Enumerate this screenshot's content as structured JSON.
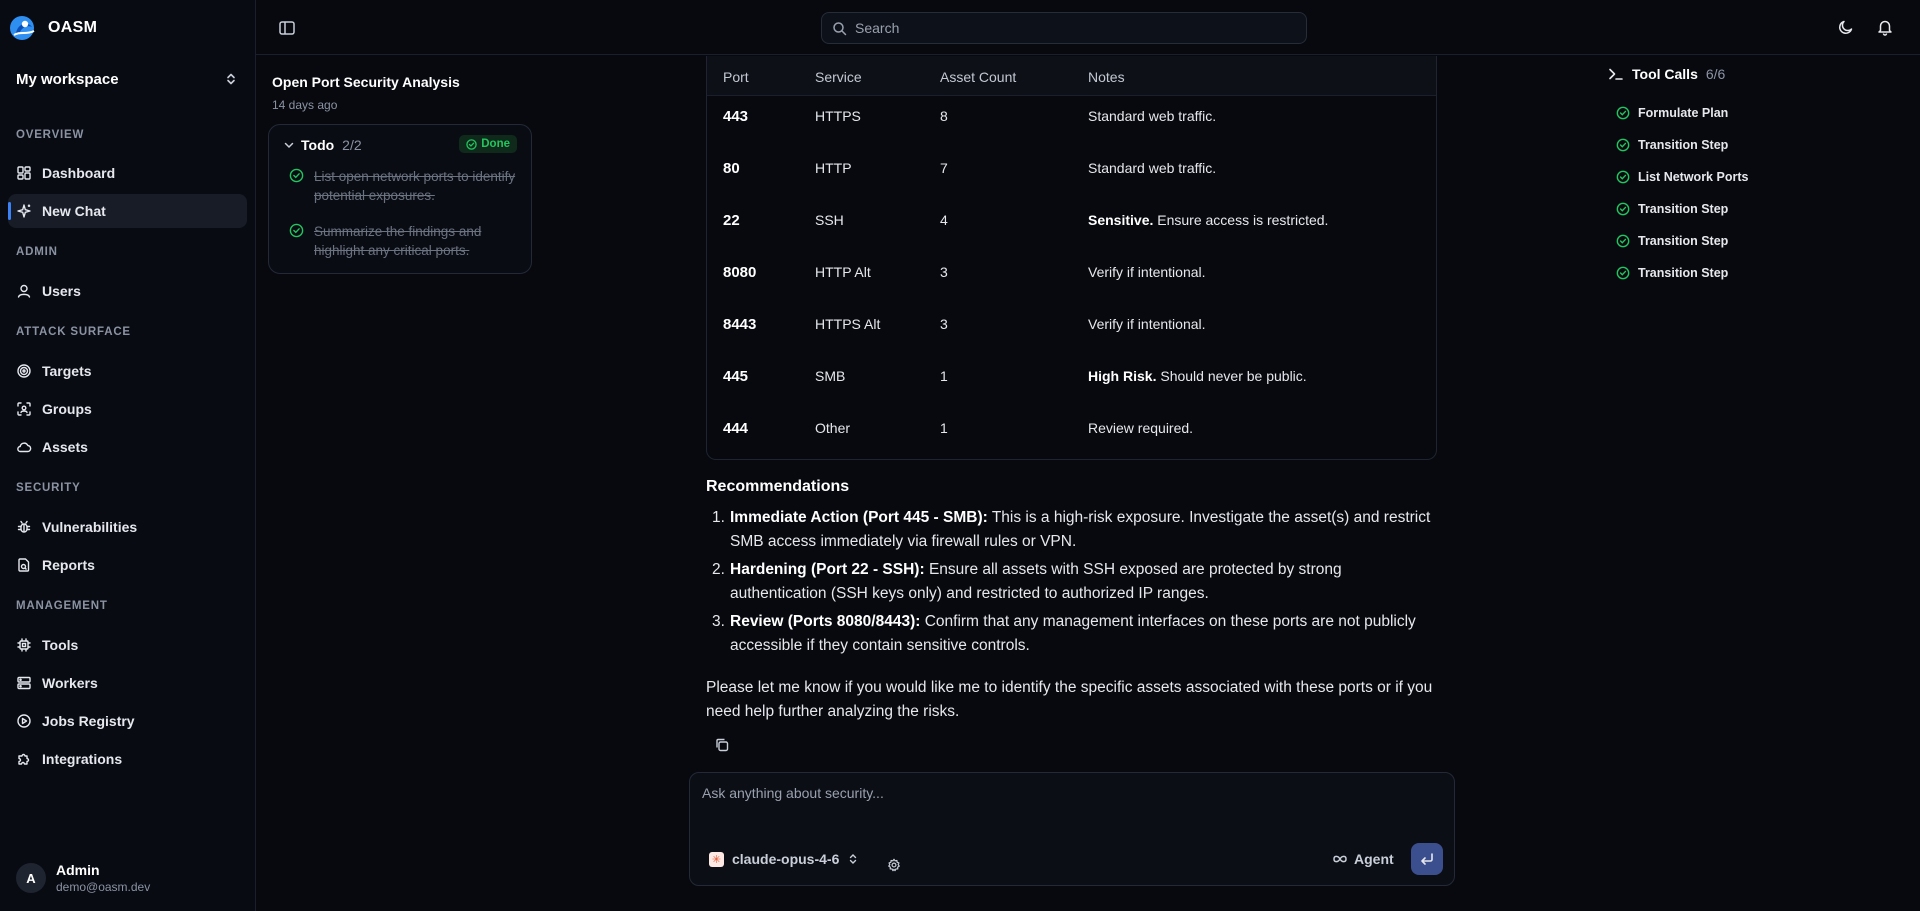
{
  "app": {
    "name": "OASM"
  },
  "workspace": {
    "label": "My workspace"
  },
  "sidebar": {
    "sections": {
      "overview": "OVERVIEW",
      "admin": "ADMIN",
      "attack_surface": "ATTACK SURFACE",
      "security": "SECURITY",
      "management": "MANAGEMENT"
    },
    "items": {
      "dashboard": "Dashboard",
      "new_chat": "New Chat",
      "users": "Users",
      "targets": "Targets",
      "groups": "Groups",
      "assets": "Assets",
      "vulnerabilities": "Vulnerabilities",
      "reports": "Reports",
      "tools": "Tools",
      "workers": "Workers",
      "jobs_registry": "Jobs Registry",
      "integrations": "Integrations"
    },
    "active": "new_chat"
  },
  "user": {
    "initial": "A",
    "name": "Admin",
    "email": "demo@oasm.dev"
  },
  "search": {
    "placeholder": "Search"
  },
  "thread": {
    "title": "Open Port Security Analysis",
    "date": "14 days ago",
    "todo": {
      "label": "Todo",
      "count": "2/2",
      "badge": "Done",
      "items": [
        "List open network ports to identify potential exposures.",
        "Summarize the findings and highlight any critical ports."
      ]
    }
  },
  "table": {
    "headers": [
      "Port",
      "Service",
      "Asset Count",
      "Notes"
    ],
    "rows": [
      {
        "port": "443",
        "service": "HTTPS",
        "count": "8",
        "note_bold": "",
        "note": "Standard web traffic."
      },
      {
        "port": "80",
        "service": "HTTP",
        "count": "7",
        "note_bold": "",
        "note": "Standard web traffic."
      },
      {
        "port": "22",
        "service": "SSH",
        "count": "4",
        "note_bold": "Sensitive.",
        "note": " Ensure access is restricted."
      },
      {
        "port": "8080",
        "service": "HTTP Alt",
        "count": "3",
        "note_bold": "",
        "note": "Verify if intentional."
      },
      {
        "port": "8443",
        "service": "HTTPS Alt",
        "count": "3",
        "note_bold": "",
        "note": "Verify if intentional."
      },
      {
        "port": "445",
        "service": "SMB",
        "count": "1",
        "note_bold": "High Risk.",
        "note": " Should never be public."
      },
      {
        "port": "444",
        "service": "Other",
        "count": "1",
        "note_bold": "",
        "note": "Review required."
      }
    ]
  },
  "recommendations": {
    "title": "Recommendations",
    "items": [
      {
        "num": "1.",
        "bold": "Immediate Action (Port 445 - SMB):",
        "text": " This is a high-risk exposure. Investigate the asset(s) and restrict SMB access immediately via firewall rules or VPN."
      },
      {
        "num": "2.",
        "bold": "Hardening (Port 22 - SSH):",
        "text": " Ensure all assets with SSH exposed are protected by strong authentication (SSH keys only) and restricted to authorized IP ranges."
      },
      {
        "num": "3.",
        "bold": "Review (Ports 8080/8443):",
        "text": " Confirm that any management interfaces on these ports are not publicly accessible if they contain sensitive controls."
      }
    ],
    "closing": "Please let me know if you would like me to identify the specific assets associated with these ports or if you need help further analyzing the risks."
  },
  "composer": {
    "placeholder": "Ask anything about security...",
    "model": "claude-opus-4-6",
    "mode": "Agent"
  },
  "tool_calls": {
    "label": "Tool Calls",
    "count": "6/6",
    "items": [
      "Formulate Plan",
      "Transition Step",
      "List Network Ports",
      "Transition Step",
      "Transition Step",
      "Transition Step"
    ]
  },
  "colors": {
    "accent": "#3b82f6",
    "success": "#22c55e",
    "background": "#07090f"
  }
}
